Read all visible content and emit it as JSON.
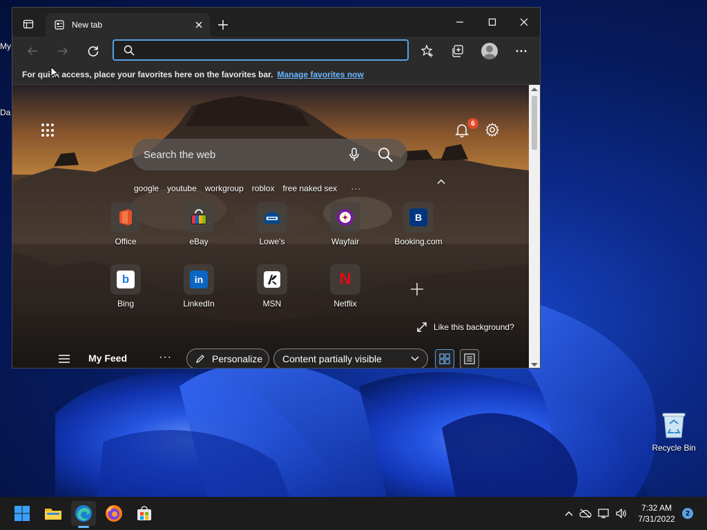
{
  "desktop": {
    "edge_text_1": "My",
    "edge_text_2": "Da",
    "recycle_bin_label": "Recycle Bin"
  },
  "browser": {
    "tab_title": "New tab",
    "address_placeholder": "",
    "favorites_bar": {
      "message": "For quick access, place your favorites here on the favorites bar.",
      "link": "Manage favorites now"
    },
    "ntp": {
      "notification_count": "6",
      "search_placeholder": "Search the web",
      "trending": [
        "google",
        "youtube",
        "workgroup",
        "roblox",
        "free naked sex"
      ],
      "trending_more": "···",
      "tiles": [
        {
          "name": "Office",
          "icon": "office-icon"
        },
        {
          "name": "eBay",
          "icon": "ebay-icon"
        },
        {
          "name": "Lowe's",
          "icon": "lowes-icon"
        },
        {
          "name": "Wayfair",
          "icon": "wayfair-icon"
        },
        {
          "name": "Booking.com",
          "icon": "booking-icon",
          "glyph": "B"
        },
        {
          "name": "Bing",
          "icon": "bing-icon",
          "glyph": "b"
        },
        {
          "name": "LinkedIn",
          "icon": "linkedin-icon",
          "glyph": "in"
        },
        {
          "name": "MSN",
          "icon": "msn-icon"
        },
        {
          "name": "Netflix",
          "icon": "netflix-icon",
          "glyph": "N"
        }
      ],
      "like_background": "Like this background?",
      "feed": {
        "title": "My Feed",
        "more": "···",
        "personalize": "Personalize",
        "content_visibility": "Content partially visible"
      }
    }
  },
  "taskbar": {
    "time": "7:32 AM",
    "date": "7/31/2022",
    "notification_count": "2"
  },
  "colors": {
    "accent": "#5aa0e6",
    "link": "#6cb6ff",
    "badge": "#e24a2a"
  }
}
